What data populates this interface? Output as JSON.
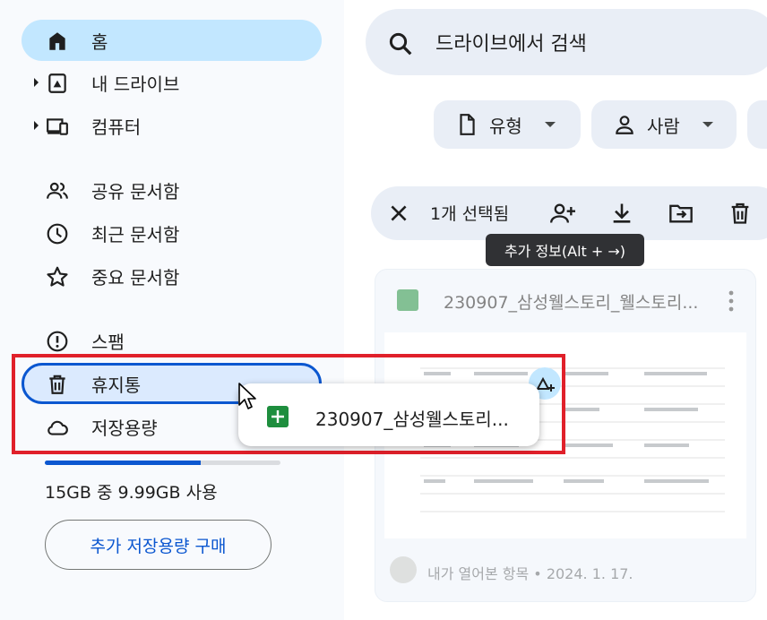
{
  "sidebar": {
    "items": [
      {
        "label": "홈"
      },
      {
        "label": "내 드라이브"
      },
      {
        "label": "컴퓨터"
      },
      {
        "label": "공유 문서함"
      },
      {
        "label": "최근 문서함"
      },
      {
        "label": "중요 문서함"
      },
      {
        "label": "스팸"
      },
      {
        "label": "휴지통"
      },
      {
        "label": "저장용량"
      }
    ],
    "quota_text": "15GB 중 9.99GB 사용",
    "quota_fraction": 0.66,
    "buy_button": "추가 저장용량 구매"
  },
  "search": {
    "placeholder": "드라이브에서 검색"
  },
  "filters": {
    "type_label": "유형",
    "people_label": "사람"
  },
  "selection": {
    "count_text": "1개 선택됨",
    "tooltip": "추가 정보(Alt + →)"
  },
  "card": {
    "title": "230907_삼성웰스토리_웰스토리...",
    "meta": "내가 열어본 항목 • 2024. 1. 17."
  },
  "drag": {
    "file_name": "230907_삼성웰스토리..."
  },
  "colors": {
    "accent": "#0b57d0",
    "active_bg": "#c2e7ff",
    "sheets_green": "#1e8e3e",
    "highlight_red": "#e0202a"
  }
}
